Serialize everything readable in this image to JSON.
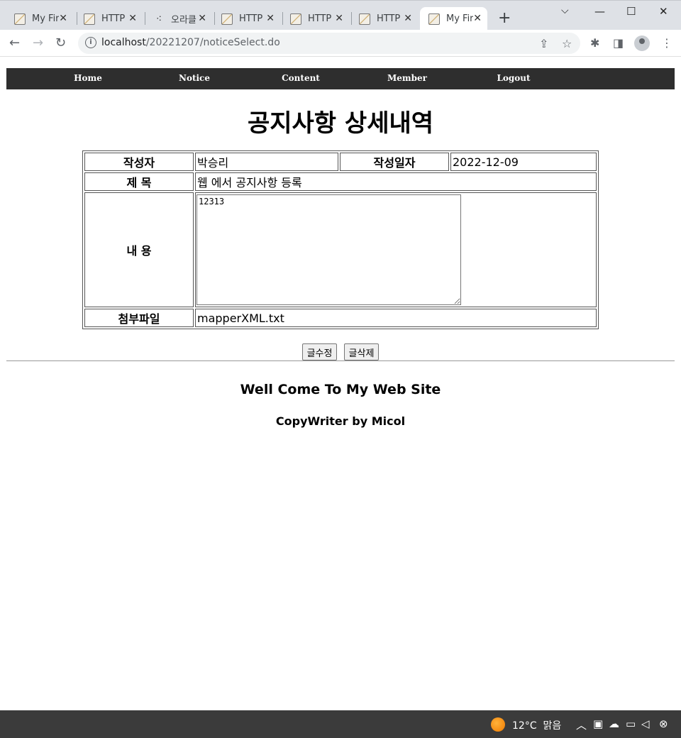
{
  "browser": {
    "tabs": [
      {
        "title": "My Fir",
        "active": false,
        "icon": "page-favicon"
      },
      {
        "title": "HTTP",
        "active": false,
        "icon": "page-favicon"
      },
      {
        "title": "오라클",
        "active": false,
        "icon": "dots-favicon"
      },
      {
        "title": "HTTP",
        "active": false,
        "icon": "page-favicon"
      },
      {
        "title": "HTTP",
        "active": false,
        "icon": "page-favicon"
      },
      {
        "title": "HTTP",
        "active": false,
        "icon": "page-favicon"
      },
      {
        "title": "My Fir",
        "active": true,
        "icon": "page-favicon"
      }
    ],
    "url_host": "localhost",
    "url_path": "/20221207/noticeSelect.do"
  },
  "menu": {
    "home": "Home",
    "notice": "Notice",
    "content": "Content",
    "member": "Member",
    "logout": "Logout"
  },
  "page_title": "공지사항 상세내역",
  "notice": {
    "author_label": "작성자",
    "author": "박승리",
    "date_label": "작성일자",
    "date": "2022-12-09",
    "subject_label": "제 목",
    "subject": "웹 에서 공지사항 등록",
    "content_label": "내 용",
    "content": "12313",
    "attachment_label": "첨부파일",
    "attachment": "mapperXML.txt"
  },
  "buttons": {
    "edit": "글수정",
    "delete": "글삭제"
  },
  "footer": {
    "title": "Well Come To My Web Site",
    "credit": "CopyWriter by Micol"
  },
  "taskbar": {
    "temperature": "12°C",
    "weather": "맑음"
  },
  "colors": {
    "menu_bg": "#2e2e2e",
    "menu_text": "#ffffff",
    "taskbar_bg": "#3b3b3b"
  }
}
